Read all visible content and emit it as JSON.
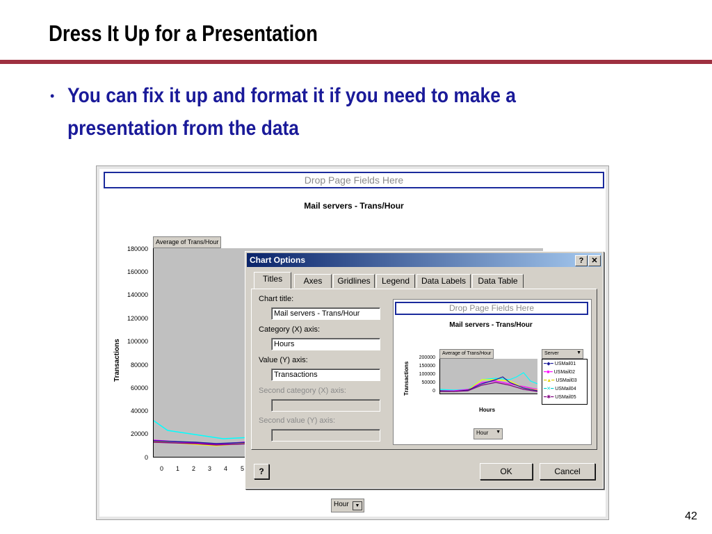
{
  "slide": {
    "title": "Dress It Up for a Presentation",
    "bullet": "You can fix it up and format it if you need to make a presentation from the data",
    "page_number": "42"
  },
  "excel": {
    "drop_page_fields": "Drop Page Fields Here",
    "chart_title": "Mail servers - Trans/Hour",
    "data_field_button": "Average of Trans/Hour",
    "y_axis_title": "Transactions",
    "y_ticks": [
      "180000",
      "160000",
      "140000",
      "120000",
      "100000",
      "80000",
      "60000",
      "40000",
      "20000",
      "0"
    ],
    "x_ticks": [
      "0",
      "1",
      "2",
      "3",
      "4",
      "5"
    ],
    "hour_field": "Hour"
  },
  "dialog": {
    "title": "Chart Options",
    "help_btn": "?",
    "close_btn": "✕",
    "tabs": [
      "Titles",
      "Axes",
      "Gridlines",
      "Legend",
      "Data Labels",
      "Data Table"
    ],
    "fields": {
      "chart_title_label": "Chart title:",
      "chart_title_value": "Mail servers - Trans/Hour",
      "category_label": "Category (X) axis:",
      "category_value": "Hours",
      "value_label": "Value (Y) axis:",
      "value_value": "Transactions",
      "second_category_label": "Second category (X) axis:",
      "second_value_label": "Second value (Y) axis:"
    },
    "preview": {
      "drop_page_fields": "Drop Page Fields Here",
      "chart_title": "Mail servers - Trans/Hour",
      "data_field_button": "Average of Trans/Hour",
      "server_field": "Server",
      "y_axis_title": "Transactions",
      "x_axis_title": "Hours",
      "y_ticks": [
        "200000",
        "150000",
        "100000",
        "50000",
        "0"
      ],
      "legend": [
        "USMail01",
        "USMail02",
        "USMail03",
        "USMail04",
        "USMail05"
      ],
      "legend_colors": [
        "#1a1a99",
        "#ff00ff",
        "#ffff00",
        "#00ffff",
        "#800080"
      ],
      "hour_field": "Hour"
    },
    "buttons": {
      "ok": "OK",
      "cancel": "Cancel"
    }
  },
  "colors": {
    "accent_rule": "#9e3040",
    "bullet_text": "#1a1a99",
    "titlebar": "#0a246a"
  }
}
